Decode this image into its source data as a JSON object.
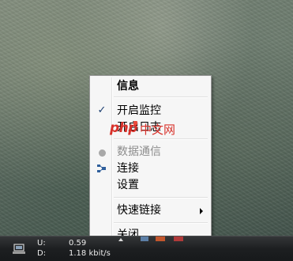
{
  "context_menu": {
    "items": [
      {
        "label": "信息",
        "bold": true
      },
      {
        "label": "开启监控",
        "checked": true
      },
      {
        "label": "开启日志"
      },
      {
        "label": "数据通信",
        "disabled": true,
        "icon": "gray-dot-icon"
      },
      {
        "label": "连接",
        "icon": "network-connect-icon"
      },
      {
        "label": "设置"
      },
      {
        "label": "快速链接",
        "has_submenu": true
      },
      {
        "label": "关闭"
      }
    ]
  },
  "watermark": {
    "brand": "php",
    "suffix": "中文网"
  },
  "taskbar": {
    "upload_label": "U:",
    "upload_value": "0.59",
    "download_label": "D:",
    "download_value": "1.18 kbit/s"
  },
  "colors": {
    "menu_background": "#f6f6f6",
    "check_mark": "#1c3e70",
    "watermark_red": "#d8312a",
    "taskbar": "#1d1f21"
  }
}
